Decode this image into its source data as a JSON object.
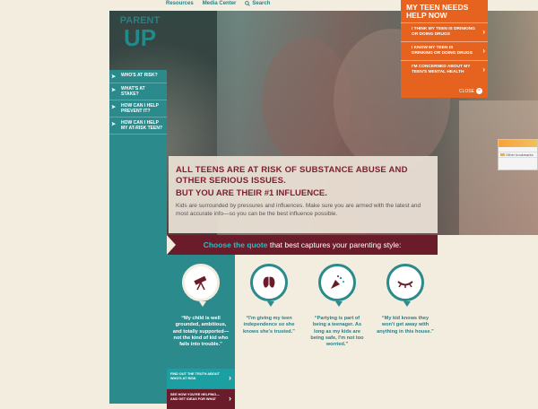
{
  "topnav": {
    "resources": "Resources",
    "media": "Media Center",
    "search": "Search"
  },
  "logo": {
    "line1": "PARENT",
    "line2": "UP"
  },
  "sidebar": {
    "items": [
      {
        "label": "WHO'S AT RISK?"
      },
      {
        "label": "WHAT'S AT STAKE?"
      },
      {
        "label": "HOW CAN I HELP PREVENT IT?"
      },
      {
        "label": "HOW CAN I HELP MY AT-RISK TEEN?"
      }
    ]
  },
  "alert": {
    "title": "MY TEEN NEEDS HELP NOW",
    "options": [
      {
        "label": "I THINK MY TEEN IS DRINKING OR DOING DRUGS"
      },
      {
        "label": "I KNOW MY TEEN IS DRINKING OR DOING DRUGS"
      },
      {
        "label": "I'M CONCERNED ABOUT MY TEEN'S MENTAL HEALTH"
      }
    ],
    "close": "CLOSE"
  },
  "popup": {
    "row_label": "Other bookmarks"
  },
  "hero": {
    "headline1": "ALL TEENS ARE AT RISK OF SUBSTANCE ABUSE AND OTHER SERIOUS ISSUES.",
    "headline2": "BUT YOU ARE THEIR #1 INFLUENCE.",
    "body": "Kids are surrounded by pressures and influences. Make sure you are armed with the latest and most accurate info—so you can be the best influence possible."
  },
  "banner": {
    "bold": "Choose the quote",
    "rest": " that best captures your parenting style:"
  },
  "cards": [
    {
      "icon": "telescope-icon",
      "quote": "“My child is well grounded, ambitious, and totally supported—not the kind of kid who fails into trouble.”"
    },
    {
      "icon": "butterfly-icon",
      "quote": "“I'm giving my teen independence so she knows she's trusted.”"
    },
    {
      "icon": "party-horn-icon",
      "quote": "“Partying is part of being a teenager. As long as my kids are being safe, I'm not too worried.”"
    },
    {
      "icon": "closed-eye-icon",
      "quote": "“My kid knows they won't get away with anything in this house.”"
    }
  ],
  "cta": {
    "first": "FIND OUT THE TRUTH ABOUT WHO'S AT RISK",
    "second": "SEE HOW YOU'RE HELPING— AND GET IDEAS FOR WHAT"
  },
  "colors": {
    "teal": "#2a8a8c",
    "maroon": "#6a1c2a",
    "orange": "#e5621f",
    "cream": "#f3ede0"
  }
}
